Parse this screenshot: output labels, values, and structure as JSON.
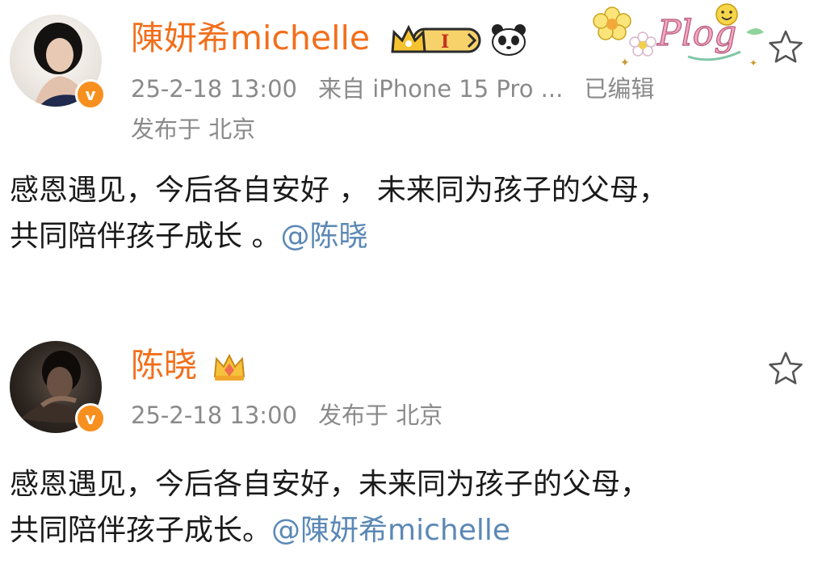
{
  "posts": [
    {
      "author": "陳妍希michelle",
      "verified_icon": "v-verified-icon",
      "time": "25-2-18 13:00",
      "source": "来自 iPhone 15 Pro ...",
      "edited": "已编辑",
      "location": "发布于 北京",
      "text_line1": "感恩遇见，今后各自安好 ， 未来同为孩子的父母，",
      "text_line2": "共同陪伴孩子成长 。",
      "mention": "@陈晓",
      "decoration": "Plog",
      "level_badge": "I"
    },
    {
      "author": "陈晓",
      "verified_icon": "v-verified-icon",
      "time": "25-2-18 13:00",
      "location": "发布于 北京",
      "text_line1": "感恩遇见，今后各自安好，未来同为孩子的父母，",
      "text_line2": "共同陪伴孩子成长。",
      "mention": "@陳妍希michelle"
    }
  ],
  "colors": {
    "author_name": "#f26f1c",
    "verified": "#f7901e",
    "meta_text": "#8a8a8a",
    "mention_link": "#5b88b5"
  }
}
